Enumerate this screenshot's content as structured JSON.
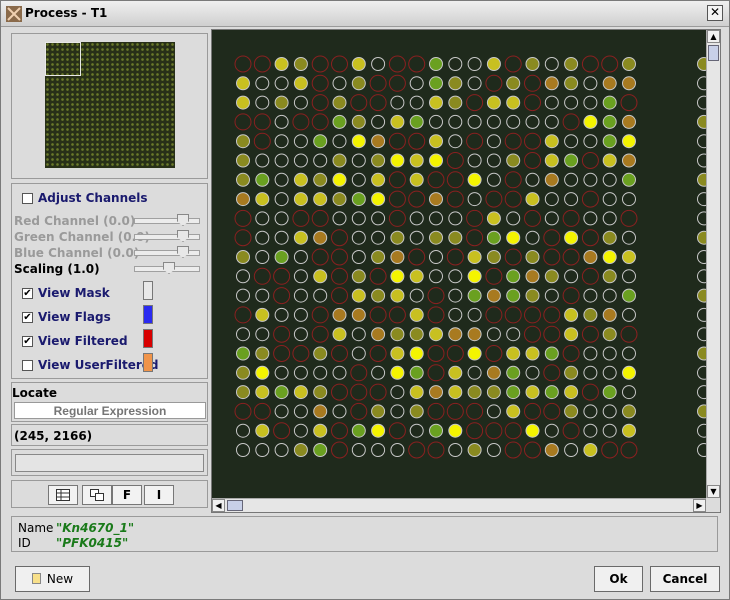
{
  "window": {
    "title": "Process - T1"
  },
  "controls": {
    "adjust_channels": {
      "label": "Adjust Channels",
      "checked": false
    },
    "red_channel": {
      "label": "Red Channel (0.0)",
      "value": 0.0
    },
    "green_channel": {
      "label": "Green Channel (0.0)",
      "value": 0.0
    },
    "blue_channel": {
      "label": "Blue Channel (0.0)",
      "value": 0.0
    },
    "scaling": {
      "label": "Scaling (1.0)",
      "value": 1.0
    },
    "view_mask": {
      "label": "View Mask",
      "checked": true,
      "color": "#e8e8e8"
    },
    "view_flags": {
      "label": "View Flags",
      "checked": true,
      "color": "#2a2af0"
    },
    "view_filtered": {
      "label": "View Filtered",
      "checked": true,
      "color": "#d80000"
    },
    "view_user_filtered": {
      "label": "View UserFiltered",
      "checked": false,
      "color": "#f0944a"
    }
  },
  "locate": {
    "label": "Locate",
    "placeholder": "Regular Expression"
  },
  "coordinates": "(245, 2166)",
  "toolbar": {
    "f_label": "F",
    "i_label": "I"
  },
  "info": {
    "name_key": "Name",
    "name_value": "\"Kn4670_1\"",
    "id_key": "ID",
    "id_value": "\"PFK0415\""
  },
  "buttons": {
    "new": "New",
    "ok": "Ok",
    "cancel": "Cancel"
  },
  "spots": {
    "rows": 21,
    "cols": 21,
    "colors": {
      "bright_yellow": "#f4f400",
      "yellow": "#c8c020",
      "olive": "#8a8a20",
      "green": "#6aa020",
      "orange": "#a87a20",
      "outline_white": "#c8c8c8",
      "outline_red": "#8a2020"
    }
  }
}
